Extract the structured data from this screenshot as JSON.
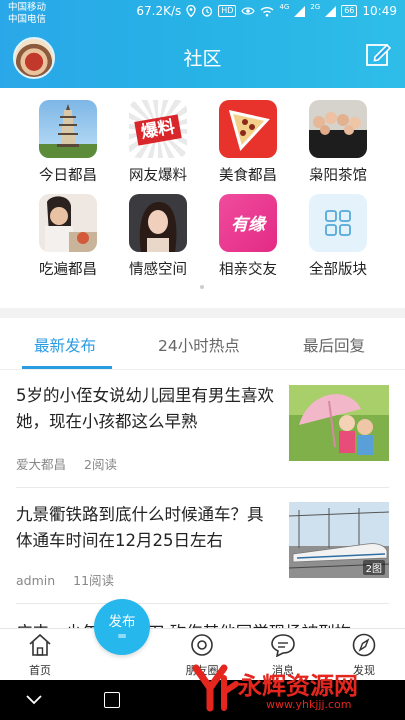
{
  "status": {
    "carrier1": "中国移动",
    "carrier2": "中国电信",
    "speed": "67.2K/s",
    "hd": "HD",
    "net1": "4G",
    "net2": "2G",
    "battery": "66",
    "time": "10:49"
  },
  "header": {
    "title": "社区"
  },
  "categories": [
    {
      "label": "今日都昌",
      "icon": "pagoda-icon"
    },
    {
      "label": "网友爆料",
      "icon": "baoliao-icon",
      "icon_text": "爆料"
    },
    {
      "label": "美食都昌",
      "icon": "pizza-icon"
    },
    {
      "label": "枭阳茶馆",
      "icon": "group-photo-icon"
    },
    {
      "label": "吃遍都昌",
      "icon": "dining-icon"
    },
    {
      "label": "情感空间",
      "icon": "portrait-icon"
    },
    {
      "label": "相亲交友",
      "icon": "youyuan-icon",
      "icon_text": "有缘"
    },
    {
      "label": "全部版块",
      "icon": "grid-icon"
    }
  ],
  "tabs": [
    {
      "label": "最新发布",
      "active": true
    },
    {
      "label": "24小时热点",
      "active": false
    },
    {
      "label": "最后回复",
      "active": false
    }
  ],
  "posts": [
    {
      "title": "5岁的小侄女说幼儿园里有男生喜欢她，现在小孩都这么早熟",
      "author": "爱大都昌",
      "reads": "2阅读",
      "image": "kids-umbrella-image",
      "img_badge": ""
    },
    {
      "title": "九景衢铁路到底什么时候通车？具体通车时间在12月25日左右",
      "author": "admin",
      "reads": "11阅读",
      "image": "train-image",
      "img_badge": "2图"
    },
    {
      "title": "广丰一少年手持砍刀 砍伤其他同学现场被刑拘",
      "author": "",
      "reads": "",
      "image": "",
      "img_badge": ""
    }
  ],
  "bottom_nav": [
    {
      "label": "首页",
      "icon": "home-icon"
    },
    {
      "label": "发布",
      "icon": "publish-icon"
    },
    {
      "label": "朋友圈",
      "icon": "camera-icon"
    },
    {
      "label": "消息",
      "icon": "message-icon"
    },
    {
      "label": "发现",
      "icon": "compass-icon"
    }
  ],
  "watermark": {
    "text": "永辉资源网",
    "url": "www.yhkjjj.com"
  },
  "colors": {
    "accent": "#2a9de2",
    "header_bg": "#2aa7e8",
    "publish_bg": "#26b7ec"
  }
}
